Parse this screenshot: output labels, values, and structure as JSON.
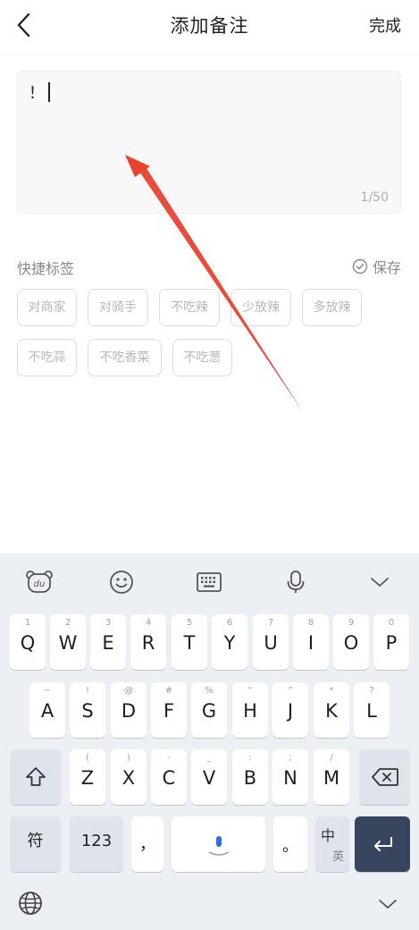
{
  "header": {
    "title": "添加备注",
    "done_label": "完成"
  },
  "note": {
    "value": "！",
    "counter": "1/50"
  },
  "quick_tags": {
    "label": "快捷标签",
    "save_label": "保存",
    "tags": [
      "对商家",
      "对骑手",
      "不吃辣",
      "少放辣",
      "多放辣",
      "不吃蒜",
      "不吃香菜",
      "不吃葱"
    ]
  },
  "keyboard": {
    "row1": [
      {
        "hint": "1",
        "key": "Q"
      },
      {
        "hint": "2",
        "key": "W"
      },
      {
        "hint": "3",
        "key": "E"
      },
      {
        "hint": "4",
        "key": "R"
      },
      {
        "hint": "5",
        "key": "T"
      },
      {
        "hint": "6",
        "key": "Y"
      },
      {
        "hint": "7",
        "key": "U"
      },
      {
        "hint": "8",
        "key": "I"
      },
      {
        "hint": "9",
        "key": "O"
      },
      {
        "hint": "0",
        "key": "P"
      }
    ],
    "row2": [
      {
        "hint": "~",
        "key": "A"
      },
      {
        "hint": "!",
        "key": "S"
      },
      {
        "hint": "@",
        "key": "D"
      },
      {
        "hint": "#",
        "key": "F"
      },
      {
        "hint": "%",
        "key": "G"
      },
      {
        "hint": "“",
        "key": "H"
      },
      {
        "hint": "”",
        "key": "J"
      },
      {
        "hint": "*",
        "key": "K"
      },
      {
        "hint": "?",
        "key": "L"
      }
    ],
    "row3": [
      {
        "hint": "(",
        "key": "Z"
      },
      {
        "hint": ")",
        "key": "X"
      },
      {
        "hint": "-",
        "key": "C"
      },
      {
        "hint": "_",
        "key": "V"
      },
      {
        "hint": ":",
        "key": "B"
      },
      {
        "hint": ";",
        "key": "N"
      },
      {
        "hint": "/",
        "key": "M"
      }
    ],
    "symbol_label": "符",
    "num_label": "123",
    "comma_label": "，",
    "period_label": "。",
    "lang_main": "中",
    "lang_sub": "英"
  },
  "colors": {
    "accent_arrow": "#e8432f",
    "enter_key": "#38455f"
  }
}
